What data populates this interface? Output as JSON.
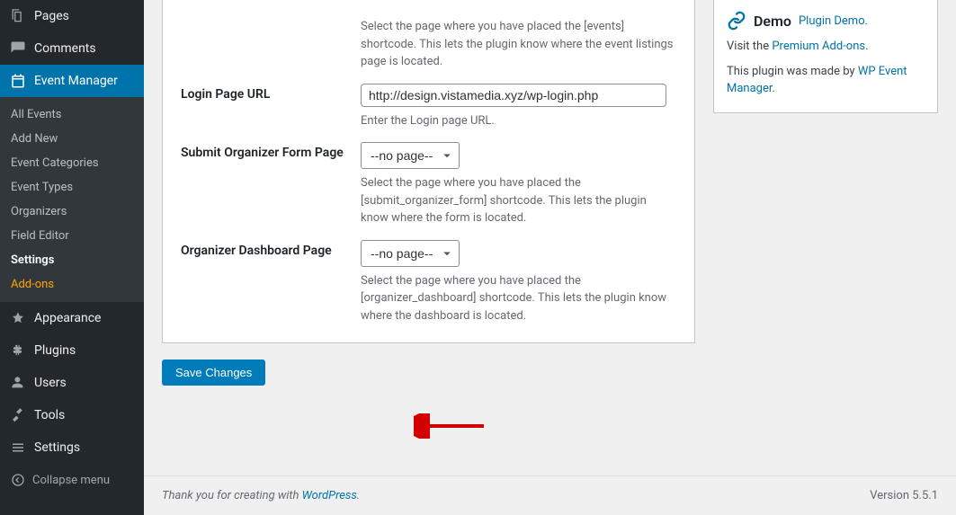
{
  "sidebar": {
    "pages": "Pages",
    "comments": "Comments",
    "event_manager": "Event Manager",
    "submenu": {
      "all_events": "All Events",
      "add_new": "Add New",
      "categories": "Event Categories",
      "types": "Event Types",
      "organizers": "Organizers",
      "field_editor": "Field Editor",
      "settings": "Settings",
      "addons": "Add-ons"
    },
    "appearance": "Appearance",
    "plugins": "Plugins",
    "users": "Users",
    "tools": "Tools",
    "settings": "Settings",
    "collapse": "Collapse menu"
  },
  "form": {
    "events_page_desc": "Select the page where you have placed the [events] shortcode. This lets the plugin know where the event listings page is located.",
    "login_label": "Login Page URL",
    "login_value": "http://design.vistamedia.xyz/wp-login.php",
    "login_desc": "Enter the Login page URL.",
    "organizer_form_label": "Submit Organizer Form Page",
    "no_page_option": "--no page--",
    "organizer_form_desc": "Select the page where you have placed the [submit_organizer_form] shortcode. This lets the plugin know where the form is located.",
    "organizer_dash_label": "Organizer Dashboard Page",
    "organizer_dash_desc": "Select the page where you have placed the [organizer_dashboard] shortcode. This lets the plugin know where the dashboard is located.",
    "save_button": "Save Changes"
  },
  "sidebox": {
    "demo_title": "Demo",
    "demo_link": "Plugin Demo.",
    "visit_prefix": "Visit the ",
    "premium_link": "Premium Add-ons",
    "made_by_prefix": "This plugin was made by ",
    "wpem_link": "WP Event Manager"
  },
  "footer": {
    "thanks_prefix": "Thank you for creating with ",
    "wp_link": "WordPress",
    "version": "Version 5.5.1"
  }
}
